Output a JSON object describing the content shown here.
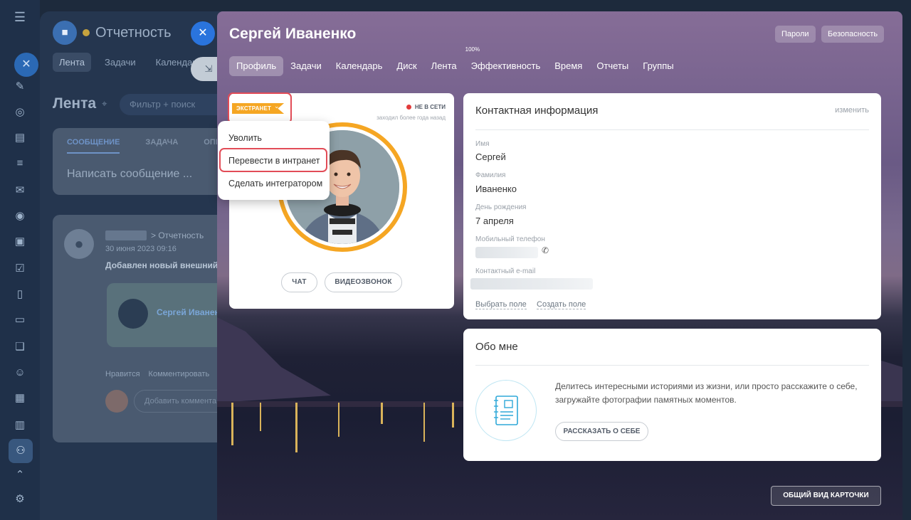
{
  "background": {
    "app_title": "Отчетность",
    "nav": [
      "Лента",
      "Задачи",
      "Календарь"
    ],
    "feed_title": "Лента",
    "filter_placeholder": "Фильтр + поиск",
    "post_tabs": [
      "СООБЩЕНИЕ",
      "ЗАДАЧА",
      "ОПРО"
    ],
    "post_placeholder": "Написать сообщение ...",
    "entry": {
      "crumb": "> Отчетность",
      "date": "30 июня 2023 09:16",
      "text": "Добавлен новый внешний",
      "card_name": "Сергей Иванен",
      "actions": [
        "Нравится",
        "Комментировать"
      ],
      "comment_placeholder": "Добавить коммента"
    }
  },
  "panel": {
    "title": "Сергей Иваненко",
    "buttons": {
      "passwords": "Пароли",
      "security": "Безопасность"
    },
    "tabs": [
      {
        "label": "Профиль",
        "active": true
      },
      {
        "label": "Задачи"
      },
      {
        "label": "Календарь"
      },
      {
        "label": "Диск"
      },
      {
        "label": "Лента"
      },
      {
        "label": "Эффективность",
        "sup": "100%"
      },
      {
        "label": "Время"
      },
      {
        "label": "Отчеты"
      },
      {
        "label": "Группы"
      }
    ]
  },
  "profile": {
    "badge": "ЭКСТРАНЕТ",
    "status": "НЕ В СЕТИ",
    "last_seen": "заходил более года назад",
    "chat_button": "ЧАТ",
    "video_button": "ВИДЕОЗВОНОК",
    "menu": [
      "Уволить",
      "Перевести в интранет",
      "Сделать интегратором"
    ]
  },
  "contact": {
    "title": "Контактная информация",
    "edit": "изменить",
    "fields": [
      {
        "label": "Имя",
        "value": "Сергей"
      },
      {
        "label": "Фамилия",
        "value": "Иваненко"
      },
      {
        "label": "День рождения",
        "value": "7 апреля"
      },
      {
        "label": "Мобильный телефон",
        "value": ""
      },
      {
        "label": "Контактный e-mail",
        "value": ""
      }
    ],
    "links": [
      "Выбрать поле",
      "Создать поле"
    ]
  },
  "about": {
    "title": "Обо мне",
    "text": "Делитесь интересными историями из жизни, или просто расскажите о себе, загружайте фотографии памятных моментов.",
    "button": "РАССКАЗАТЬ О СЕБЕ"
  },
  "overview_button": "ОБЩИЙ ВИД КАРТОЧКИ",
  "colors": {
    "accent_orange": "#f5a623",
    "highlight_red": "#e24c57",
    "offline_red": "#e23b3b"
  }
}
